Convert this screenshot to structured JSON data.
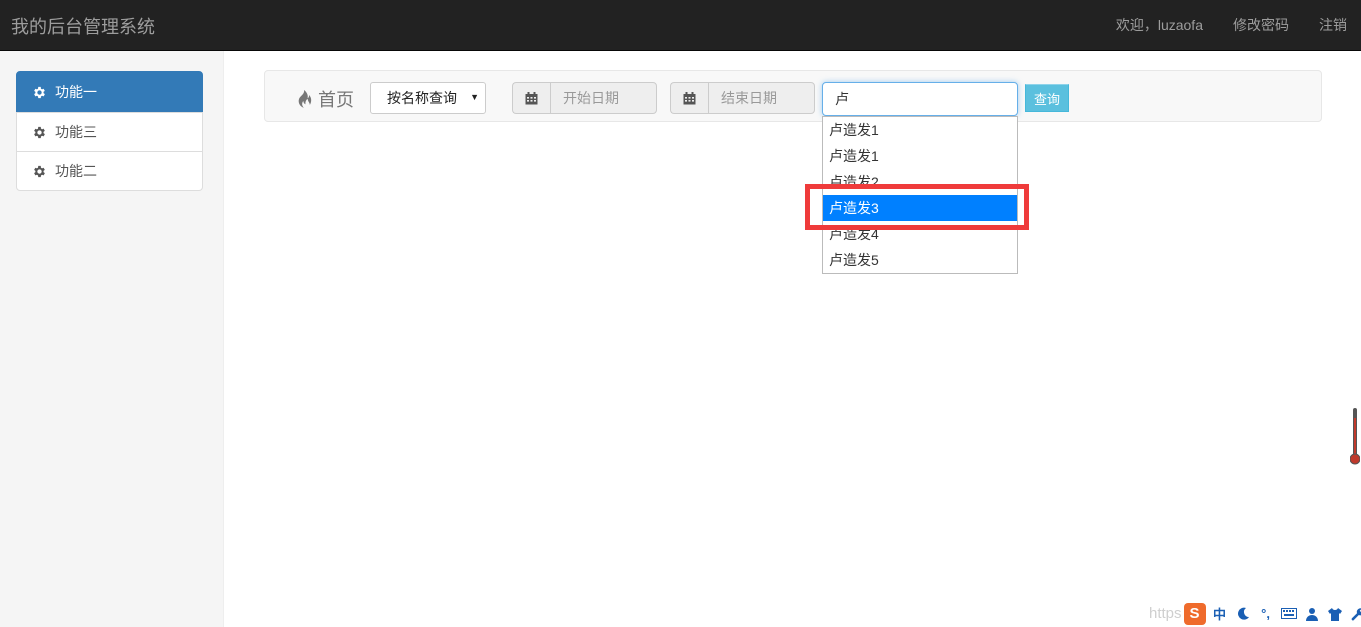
{
  "navbar": {
    "brand": "我的后台管理系统",
    "welcome": "欢迎，luzaofa",
    "change_password": "修改密码",
    "logout": "注销"
  },
  "sidebar": {
    "items": [
      {
        "label": "功能一",
        "icon": "gear-icon",
        "active": true
      },
      {
        "label": "功能三",
        "icon": "gear-icon",
        "active": false
      },
      {
        "label": "功能二",
        "icon": "gear-icon",
        "active": false
      }
    ]
  },
  "search_bar": {
    "home_label": "首页",
    "home_icon": "fire-icon",
    "query_type_selected": "按名称查询",
    "start_date_placeholder": "开始日期",
    "end_date_placeholder": "结束日期",
    "calendar_icon": "calendar-icon",
    "search_value": "卢",
    "query_button": "查询"
  },
  "autocomplete": {
    "items": [
      "卢造发1",
      "卢造发1",
      "卢造发2",
      "卢造发3",
      "卢造发4",
      "卢造发5"
    ],
    "selected_item": "卢造发3"
  },
  "tray": {
    "watermark": "https",
    "ime_logo": "S",
    "ime_mode": "中"
  },
  "colors": {
    "navbar_bg": "#222222",
    "sidebar_active": "#337ab7",
    "query_button": "#5bc0de",
    "dropdown_selected": "#0080ff",
    "highlight_box": "#ef3b3b"
  }
}
